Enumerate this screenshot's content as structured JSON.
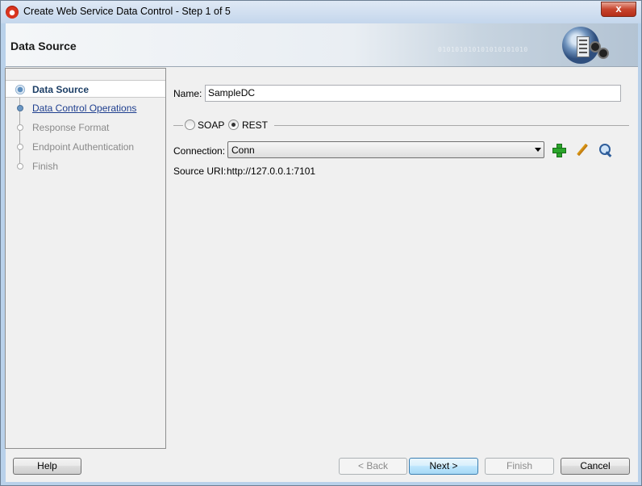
{
  "window": {
    "title": "Create Web Service Data Control - Step 1 of 5",
    "close_glyph": "x"
  },
  "header": {
    "title": "Data Source",
    "binary_decoration": "010101010101010101010"
  },
  "steps": [
    {
      "label": "Data Source",
      "state": "current"
    },
    {
      "label": "Data Control Operations",
      "state": "link"
    },
    {
      "label": "Response Format",
      "state": "disabled"
    },
    {
      "label": "Endpoint Authentication",
      "state": "disabled"
    },
    {
      "label": "Finish",
      "state": "disabled"
    }
  ],
  "form": {
    "name_label": "Name:",
    "name_value": "SampleDC",
    "radio_soap": "SOAP",
    "radio_rest": "REST",
    "selected_protocol": "REST",
    "connection_label": "Connection:",
    "connection_value": "Conn",
    "source_uri_label": "Source URI:",
    "source_uri_value": "http://127.0.0.1:7101"
  },
  "buttons": {
    "help": "Help",
    "back": "< Back",
    "next": "Next >",
    "finish": "Finish",
    "cancel": "Cancel"
  },
  "icons": {
    "add": "plus-icon",
    "edit": "pencil-icon",
    "browse": "magnify-icon"
  },
  "colors": {
    "title_bar": "#c4d6ec",
    "close_button": "#c7442d",
    "link": "#1f3f8f",
    "add_icon": "#2aa52a"
  }
}
